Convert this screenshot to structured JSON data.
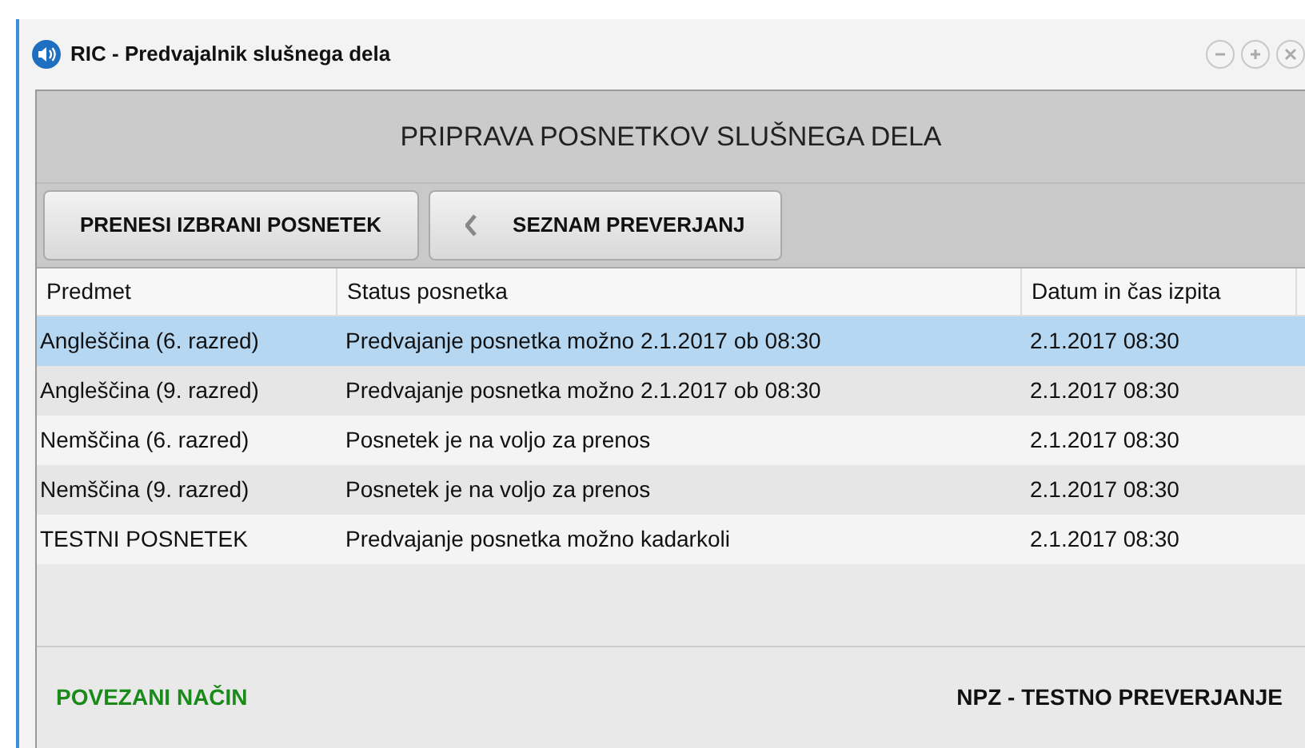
{
  "window": {
    "title": "RIC - Predvajalnik slušnega dela"
  },
  "header": {
    "title": "PRIPRAVA POSNETKOV SLUŠNEGA DELA"
  },
  "toolbar": {
    "buttons": [
      {
        "kind": "plain",
        "label": "PRENESI IZBRANI POSNETEK"
      },
      {
        "kind": "back",
        "label": "SEZNAM PREVERJANJ"
      }
    ]
  },
  "table": {
    "columns": [
      "Predmet",
      "Status posnetka",
      "Datum in čas izpita"
    ],
    "rows": [
      {
        "cells": [
          "Angleščina (6. razred)",
          "Predvajanje posnetka možno 2.1.2017 ob 08:30",
          "2.1.2017 08:30"
        ],
        "selected": true
      },
      {
        "cells": [
          "Angleščina (9. razred)",
          "Predvajanje posnetka možno 2.1.2017 ob 08:30",
          "2.1.2017 08:30"
        ],
        "selected": false
      },
      {
        "cells": [
          "Nemščina (6. razred)",
          "Posnetek je na voljo za prenos",
          "2.1.2017 08:30"
        ],
        "selected": false
      },
      {
        "cells": [
          "Nemščina (9. razred)",
          "Posnetek je na voljo za prenos",
          "2.1.2017 08:30"
        ],
        "selected": false
      },
      {
        "cells": [
          "TESTNI POSNETEK",
          "Predvajanje posnetka možno kadarkoli",
          "2.1.2017 08:30"
        ],
        "selected": false
      }
    ]
  },
  "status_bar": {
    "mode": "POVEZANI NAČIN",
    "exam": "NPZ - TESTNO PREVERJANJE"
  }
}
